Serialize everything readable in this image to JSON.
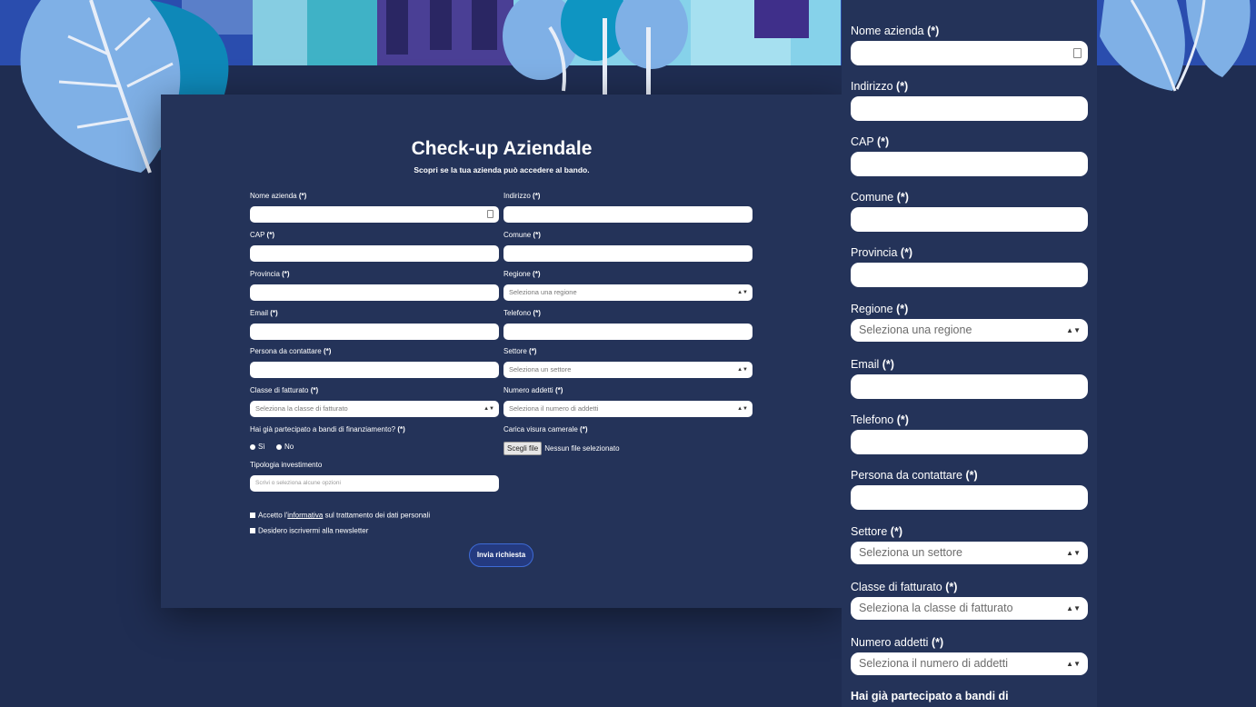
{
  "card": {
    "title": "Check-up Aziendale",
    "subtitle": "Scopri se la tua azienda può accedere al bando.",
    "fields": {
      "nome_azienda": "Nome azienda",
      "indirizzo": "Indirizzo",
      "cap": "CAP",
      "comune": "Comune",
      "provincia": "Provincia",
      "regione": "Regione",
      "email": "Email",
      "telefono": "Telefono",
      "persona": "Persona da contattare",
      "settore": "Settore",
      "classe": "Classe di fatturato",
      "numero": "Numero addetti",
      "bandi": "Hai già partecipato a bandi di finanziamento?",
      "visura": "Carica visura camerale",
      "tipologia": "Tipologia investimento"
    },
    "required_mark": "(*)",
    "selects": {
      "regione": "Seleziona una regione",
      "settore": "Seleziona un settore",
      "classe": "Seleziona la classe di fatturato",
      "numero": "Seleziona il numero di addetti"
    },
    "radio": {
      "yes": "Sì",
      "no": "No"
    },
    "file": {
      "button": "Scegli file",
      "status": "Nessun file selezionato"
    },
    "tipologia_placeholder": "Scrivi o seleziona alcune opzioni",
    "privacy": {
      "before": "Accetto l'",
      "link": "informativa",
      "after": " sul trattamento dei dati personali"
    },
    "newsletter": "Desidero iscrivermi alla newsletter",
    "submit": "Invia richiesta"
  },
  "panel": {
    "fields": {
      "nome_azienda": "Nome azienda",
      "indirizzo": "Indirizzo",
      "cap": "CAP",
      "comune": "Comune",
      "provincia": "Provincia",
      "regione": "Regione",
      "email": "Email",
      "telefono": "Telefono",
      "persona": "Persona da contattare",
      "settore": "Settore",
      "classe": "Classe di fatturato",
      "numero": "Numero addetti",
      "bandi_partial": "Hai già partecipato a bandi di"
    },
    "selects": {
      "regione": "Seleziona una regione",
      "settore": "Seleziona un settore",
      "classe": "Seleziona la classe di fatturato",
      "numero": "Seleziona il numero di addetti"
    }
  },
  "colors": {
    "background": "#1f2d52",
    "card": "#243359",
    "accent": "#3e6bd6",
    "leaf": "#7fb0e6"
  },
  "icons": {
    "select": "up-down-arrows-icon",
    "contact": "contact-card-icon"
  }
}
